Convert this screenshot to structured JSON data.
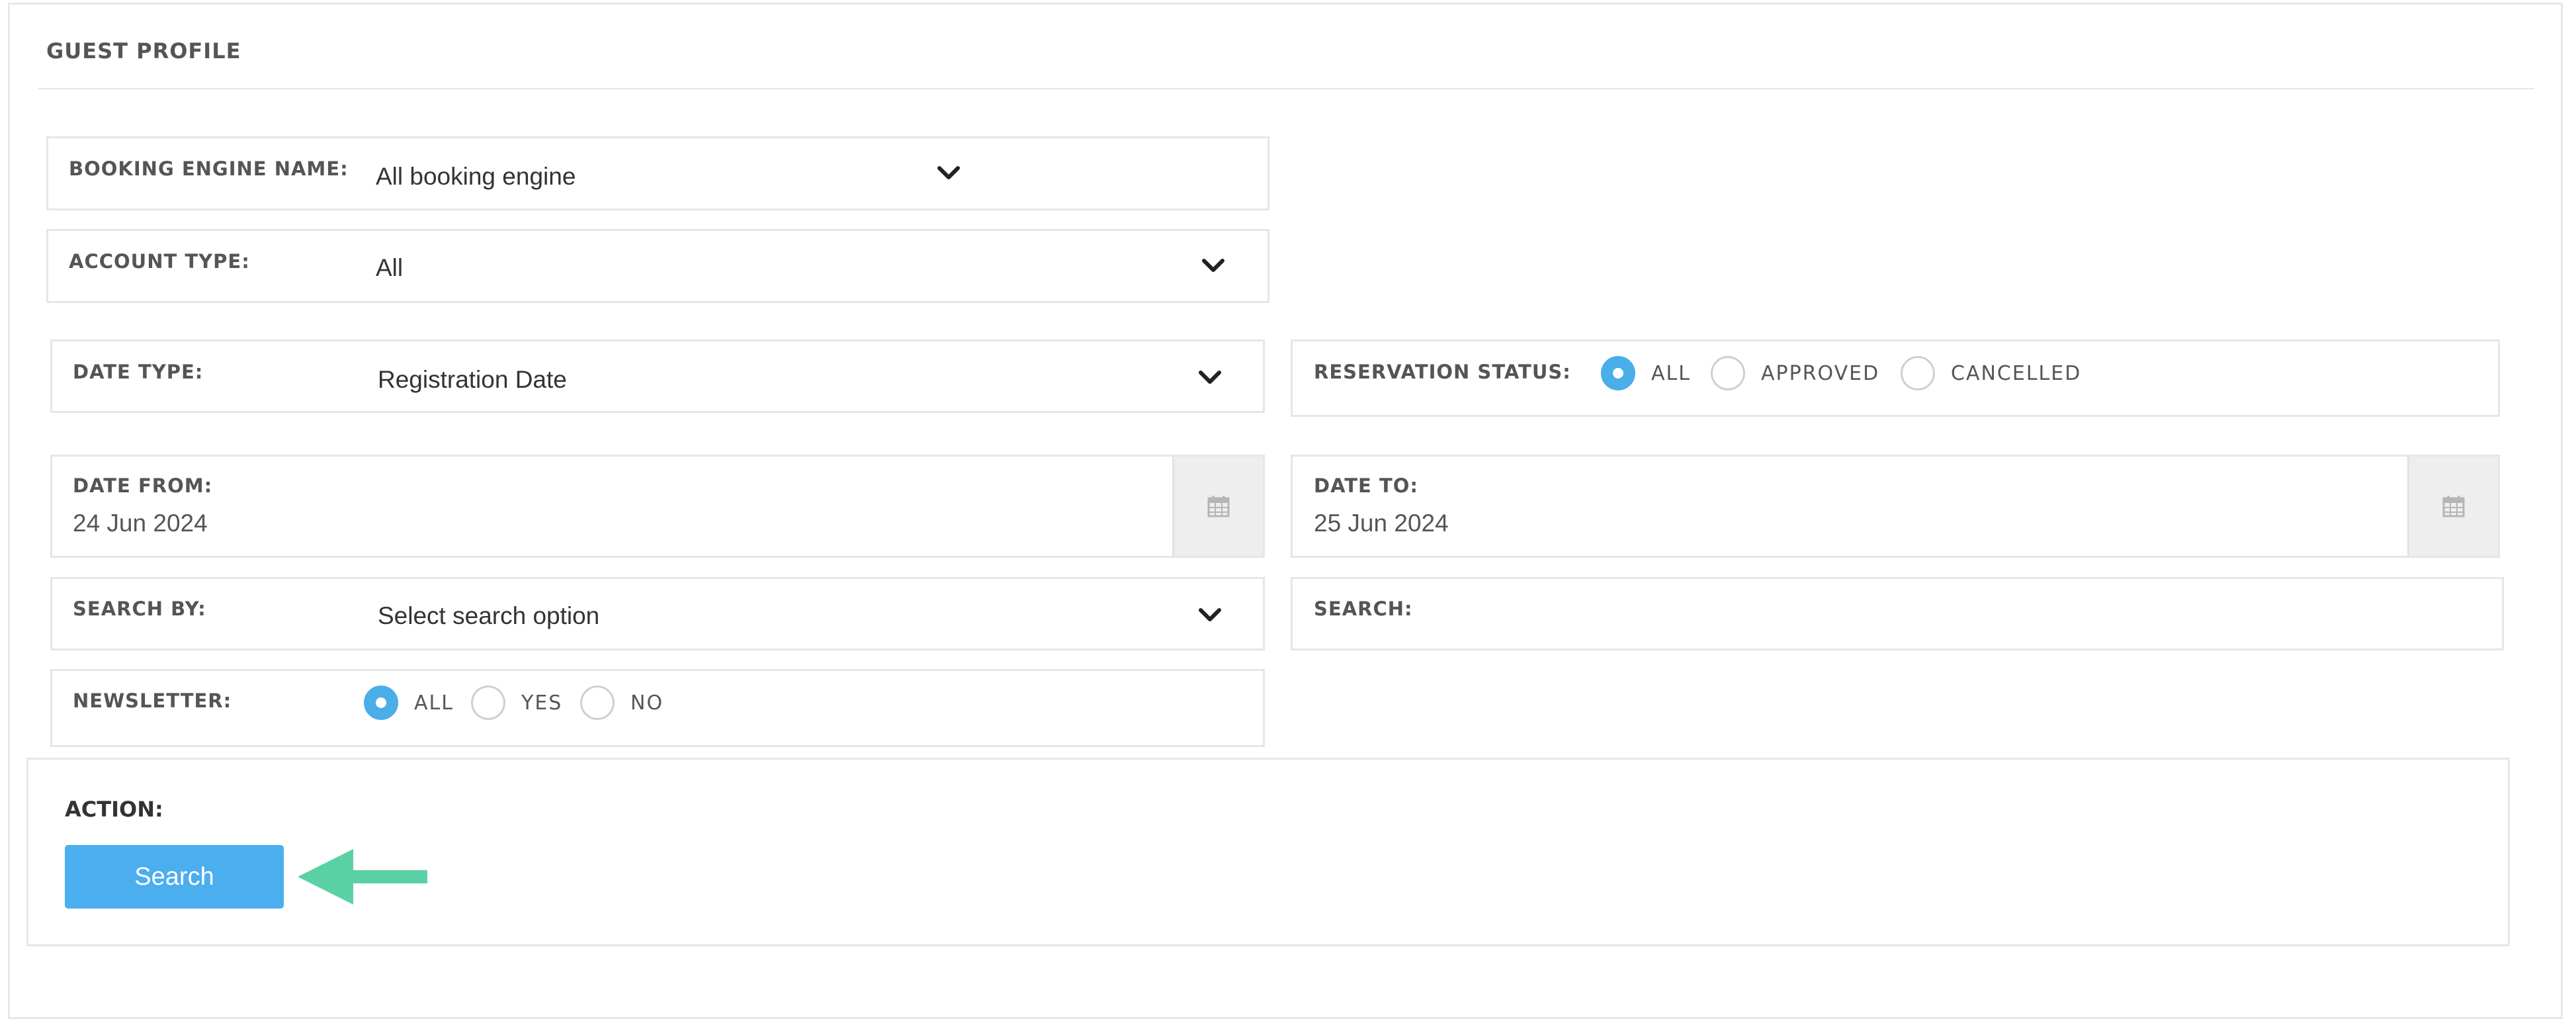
{
  "panel": {
    "title": "GUEST PROFILE"
  },
  "booking_engine": {
    "label": "BOOKING ENGINE NAME:",
    "value": "All booking engine",
    "icon": "chevron-down-icon"
  },
  "account_type": {
    "label": "ACCOUNT TYPE:",
    "value": "All",
    "icon": "chevron-down-icon"
  },
  "date_type": {
    "label": "DATE TYPE:",
    "value": "Registration Date",
    "icon": "chevron-down-icon"
  },
  "reservation_status": {
    "label": "RESERVATION STATUS:",
    "options": [
      {
        "label": "ALL",
        "checked": true
      },
      {
        "label": "APPROVED",
        "checked": false
      },
      {
        "label": "CANCELLED",
        "checked": false
      }
    ]
  },
  "date_from": {
    "label": "DATE FROM:",
    "value": "24 Jun 2024",
    "icon": "calendar-icon"
  },
  "date_to": {
    "label": "DATE TO:",
    "value": "25 Jun 2024",
    "icon": "calendar-icon"
  },
  "search_by": {
    "label": "SEARCH BY:",
    "value": "Select search option",
    "icon": "chevron-down-icon"
  },
  "search": {
    "label": "SEARCH:",
    "value": ""
  },
  "newsletter": {
    "label": "NEWSLETTER:",
    "options": [
      {
        "label": "ALL",
        "checked": true
      },
      {
        "label": "YES",
        "checked": false
      },
      {
        "label": "NO",
        "checked": false
      }
    ]
  },
  "action": {
    "label": "ACTION:",
    "button_label": "Search"
  },
  "colors": {
    "accent": "#4aaeef",
    "arrow": "#5ad1a4",
    "border": "#e6e6e6"
  }
}
